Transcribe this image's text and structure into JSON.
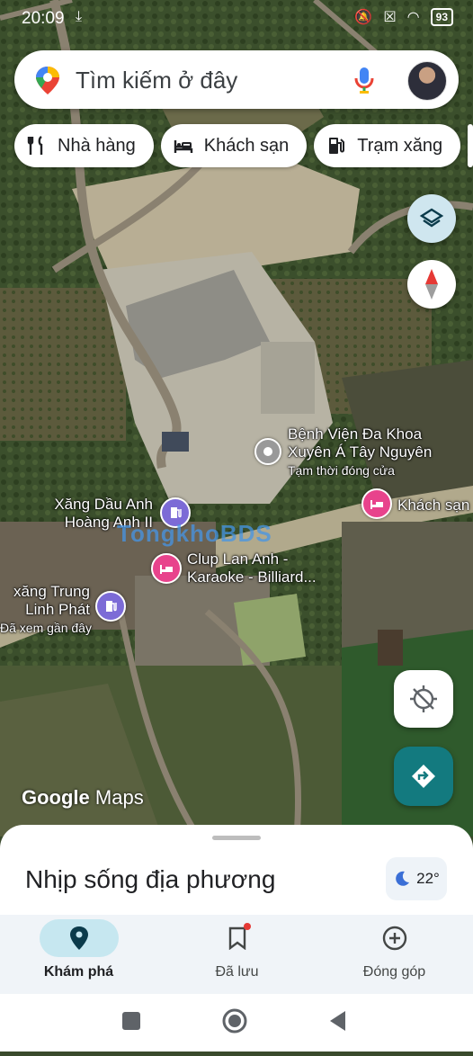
{
  "status": {
    "time": "20:09",
    "battery": "93"
  },
  "search": {
    "placeholder": "Tìm kiếm ở đây"
  },
  "chips": [
    {
      "label": "Nhà hàng",
      "icon": "restaurant-icon"
    },
    {
      "label": "Khách sạn",
      "icon": "hotel-icon"
    },
    {
      "label": "Trạm xăng",
      "icon": "gas-station-icon"
    }
  ],
  "map": {
    "labels": {
      "hospital_line1": "Bệnh Viện Đa Khoa",
      "hospital_line2": "Xuyên Á Tây Nguyên",
      "hospital_status": "Tạm thời đóng cửa",
      "hotel": "Khách sạn",
      "gas1_line1": "Xăng Dầu Anh",
      "gas1_line2": "Hoàng Anh II",
      "karaoke_line1": "Clup Lan Anh -",
      "karaoke_line2": "Karaoke - Billiard...",
      "gas2_line1": "xăng Trung",
      "gas2_line2": "Linh Phát",
      "gas2_note": "Đã xem gần đây"
    },
    "watermark": "TongkhoBDS",
    "logo_google": "Google",
    "logo_maps": "Maps"
  },
  "sheet": {
    "title": "Nhịp sống địa phương",
    "temperature": "22°"
  },
  "nav": {
    "explore": "Khám phá",
    "saved": "Đã lưu",
    "contribute": "Đóng góp"
  },
  "colors": {
    "accent": "#137a7f",
    "nav_active": "#c6e7f0",
    "hotel_pin": "#e8438c",
    "gas_pin": "#7c6bd6"
  }
}
